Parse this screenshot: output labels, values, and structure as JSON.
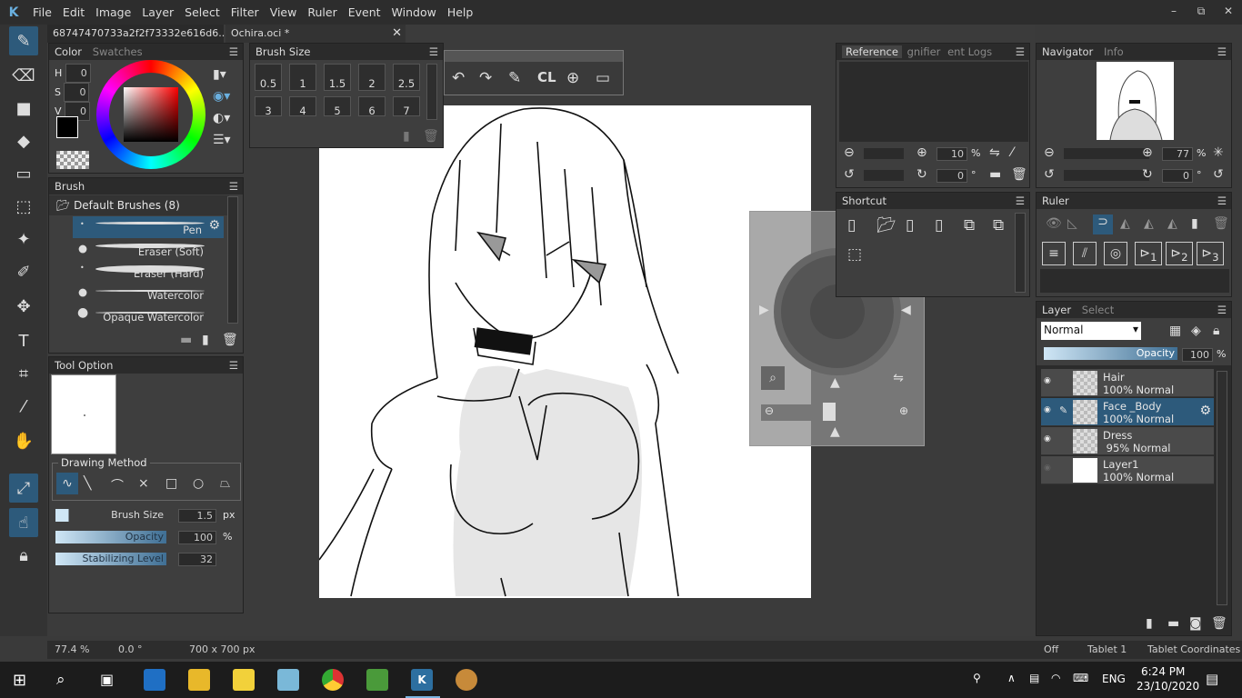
{
  "menu": [
    "File",
    "Edit",
    "Image",
    "Layer",
    "Select",
    "Filter",
    "View",
    "Ruler",
    "Event",
    "Window",
    "Help"
  ],
  "window_controls": [
    "–",
    "⧉",
    "✕"
  ],
  "doc_tabs": [
    {
      "label": "68747470733a2f2f73332e616d6...",
      "close": "✕"
    },
    {
      "label": "Ochira.oci *",
      "close": "✕"
    }
  ],
  "color_panel": {
    "tab_color": "Color",
    "tab_swatches": "Swatches",
    "h_label": "H",
    "s_label": "S",
    "v_label": "V",
    "h": "0",
    "s": "0",
    "v": "0"
  },
  "brush_size_panel": {
    "title": "Brush Size",
    "sizes": [
      "0.5",
      "1",
      "1.5",
      "2",
      "2.5"
    ],
    "sizes_row2": [
      "3",
      "4",
      "5",
      "6",
      "7"
    ]
  },
  "brush_panel": {
    "title": "Brush",
    "group": "Default Brushes (8)",
    "items": [
      "Pen",
      "Eraser (Soft)",
      "Eraser (Hard)",
      "Watercolor",
      "Opaque Watercolor"
    ]
  },
  "tool_option": {
    "title": "Tool Option",
    "drawing_method": "Drawing Method",
    "brush_size_label": "Brush Size",
    "brush_size": "1.5",
    "brush_size_unit": "px",
    "opacity_label": "Opacity",
    "opacity": "100",
    "opacity_unit": "%",
    "stabilizing_label": "Stabilizing Level",
    "stabilizing": "32"
  },
  "reference_panel": {
    "tab_reference": "Reference",
    "tab_magnifier": "gnifier",
    "tab_event_logs": "ent Logs",
    "zoom": "10",
    "zoom_unit": "%",
    "rotation": "0",
    "rotation_unit": "°"
  },
  "navigator_panel": {
    "tab_navigator": "Navigator",
    "tab_info": "Info",
    "zoom": "77",
    "zoom_unit": "%",
    "rotation": "0",
    "rotation_unit": "°"
  },
  "shortcut_panel": {
    "title": "Shortcut"
  },
  "ruler_panel": {
    "title": "Ruler",
    "sub_labels": [
      "1",
      "2",
      "3"
    ]
  },
  "layer_panel": {
    "tab_layer": "Layer",
    "tab_select": "Select",
    "blend_mode": "Normal",
    "opacity_label": "Opacity",
    "opacity": "100",
    "opacity_unit": "%",
    "layers": [
      {
        "name": "Hair",
        "info": "100% Normal"
      },
      {
        "name": "Face _Body",
        "info": "100% Normal"
      },
      {
        "name": "Dress",
        "info": " 95% Normal"
      },
      {
        "name": "Layer1",
        "info": "100% Normal"
      }
    ]
  },
  "status": {
    "zoom": "77.4 %",
    "angle": "0.0 °",
    "size": "700 x 700 px",
    "mode": "Off",
    "tablet": "Tablet 1",
    "coords": "Tablet Coordinates"
  },
  "taskbar": {
    "lang": "ENG",
    "time": "6:24 PM",
    "date": "23/10/2020"
  },
  "accent": "#2d5a7b"
}
